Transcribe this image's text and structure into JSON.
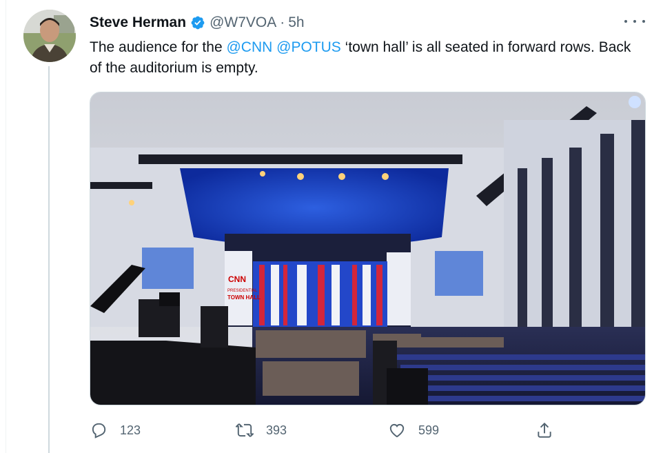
{
  "tweet": {
    "author_name": "Steve Herman",
    "handle": "@W7VOA",
    "separator": "·",
    "time": "5h",
    "text_before": "The audience for the ",
    "mention_1": "@CNN",
    "space": " ",
    "mention_2": "@POTUS",
    "text_after": " ‘town hall’ is all seated in forward rows. Back of the auditorium is empty.",
    "screen_logo": "CNN",
    "screen_text_1": "PRESIDENTIAL",
    "screen_text_2": "TOWN HALL"
  },
  "actions": {
    "replies": "123",
    "retweets": "393",
    "likes": "599"
  },
  "colors": {
    "link": "#1d9bf0",
    "text": "#0f1419",
    "secondary": "#536471",
    "verified": "#1d9bf0"
  },
  "icons": [
    "verified-badge-icon",
    "more-options-icon",
    "reply-icon",
    "retweet-icon",
    "like-icon",
    "share-icon"
  ]
}
